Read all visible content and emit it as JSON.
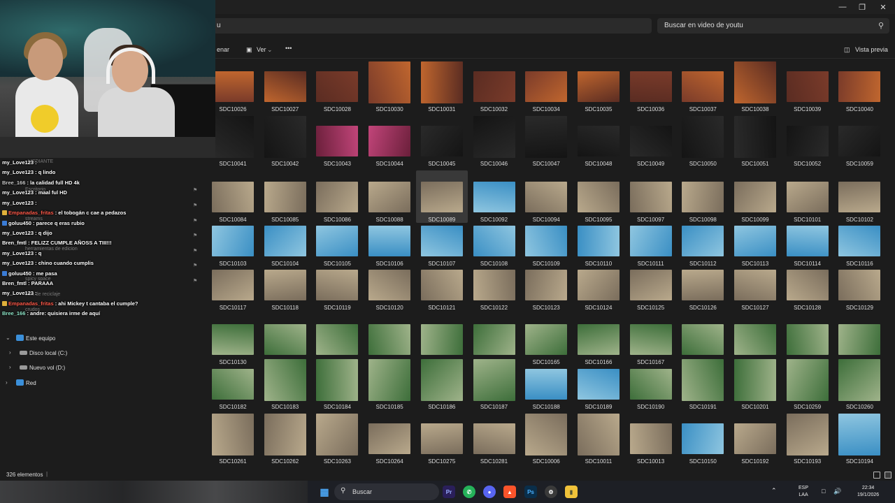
{
  "window": {
    "minimize": "—",
    "maximize": "❐",
    "close": "✕"
  },
  "address": {
    "value": "u"
  },
  "search": {
    "placeholder": "Buscar en video de youtu"
  },
  "commands": {
    "sort": "enar",
    "view": "Ver",
    "more": "•••",
    "preview": "Vista previa"
  },
  "files": [
    [
      "SDC10026",
      "SDC10027",
      "SDC10028",
      "SDC10030",
      "SDC10031",
      "SDC10032",
      "SDC10034",
      "SDC10035",
      "SDC10036",
      "SDC10037",
      "SDC10038",
      "SDC10039",
      "SDC10040"
    ],
    [
      "SDC10041",
      "SDC10042",
      "SDC10043",
      "SDC10044",
      "SDC10045",
      "SDC10046",
      "SDC10047",
      "SDC10048",
      "SDC10049",
      "SDC10050",
      "SDC10051",
      "SDC10052",
      "SDC10059"
    ],
    [
      "SDC10084",
      "SDC10085",
      "SDC10086",
      "SDC10088",
      "SDC10089",
      "SDC10092",
      "SDC10094",
      "SDC10095",
      "SDC10097",
      "SDC10098",
      "SDC10099",
      "SDC10101",
      "SDC10102"
    ],
    [
      "SDC10103",
      "SDC10104",
      "SDC10105",
      "SDC10106",
      "SDC10107",
      "SDC10108",
      "SDC10109",
      "SDC10110",
      "SDC10111",
      "SDC10112",
      "SDC10113",
      "SDC10114",
      "SDC10116"
    ],
    [
      "SDC10117",
      "SDC10118",
      "SDC10119",
      "SDC10120",
      "SDC10121",
      "SDC10122",
      "SDC10123",
      "SDC10124",
      "SDC10125",
      "SDC10126",
      "SDC10127",
      "SDC10128",
      "SDC10129"
    ],
    [
      "SDC10130",
      "SDC10131",
      "SDC10161",
      "SDC10162",
      "SDC10163",
      "SDC10164",
      "SDC10165",
      "SDC10166",
      "SDC10167",
      "SDC10176",
      "SDC10177",
      "SDC10178",
      "SDC10179"
    ],
    [
      "SDC10182",
      "SDC10183",
      "SDC10184",
      "SDC10185",
      "SDC10186",
      "SDC10187",
      "SDC10188",
      "SDC10189",
      "SDC10190",
      "SDC10191",
      "SDC10201",
      "SDC10259",
      "SDC10260"
    ],
    [
      "SDC10261",
      "SDC10262",
      "SDC10263",
      "SDC10264",
      "SDC10275",
      "SDC10281",
      "SDC10006",
      "SDC10011",
      "SDC10013",
      "SDC10150",
      "SDC10192",
      "SDC10193",
      "SDC10194"
    ]
  ],
  "selected_file": "SDC10089",
  "thumb_colors": {
    "party": [
      "#7a3b2a",
      "#c0662e",
      "#5a2c22"
    ],
    "night": [
      "#141414",
      "#2a2a2a"
    ],
    "pink": [
      "#c2457a",
      "#6a1f3a"
    ],
    "pool": [
      "#3a8fc4",
      "#8fc6e0"
    ],
    "yard": [
      "#7a6d5c",
      "#b9a98c"
    ],
    "green": [
      "#3d6e3a",
      "#9fb38a"
    ]
  },
  "nav": {
    "this_pc": "Este equipo",
    "disk_c": "Disco local (C:)",
    "disk_d": "Nuevo vol (D:)",
    "network": "Red"
  },
  "nav_ghost": [
    "Escritorio",
    "streams",
    "herramientas de edicion",
    "spicy space",
    "sala de reciclaje",
    "crudos",
    "MEDIANTE"
  ],
  "chat": [
    {
      "user": "my_Love123",
      "color": "#ffffff",
      "msg": ":"
    },
    {
      "user": "my_Love123",
      "color": "#ffffff",
      "msg": ": q lindo"
    },
    {
      "user": "Bree_166",
      "color": "#c8c8c8",
      "msg": ": la calidad full HD 4k"
    },
    {
      "user": "my_Love123",
      "color": "#ffffff",
      "msg": ": maal ful HD"
    },
    {
      "user": "my_Love123",
      "color": "#ffffff",
      "msg": ":"
    },
    {
      "user": "Empanadas_fritas",
      "color": "#ff5a4a",
      "msg": ": el tobogán c cae a pedazos"
    },
    {
      "user": "goluu450",
      "color": "#ffffff",
      "msg": ": parece q eras rubio"
    },
    {
      "user": "my_Love123",
      "color": "#ffffff",
      "msg": ": q dijo"
    },
    {
      "user": "Bren_fmtl",
      "color": "#ffffff",
      "msg": ": FELIZZ CUMPLE AÑOSS A TIII!!!"
    },
    {
      "user": "my_Love123",
      "color": "#ffffff",
      "msg": ": q"
    },
    {
      "user": "my_Love123",
      "color": "#ffffff",
      "msg": ": chino cuando cumplis"
    },
    {
      "user": "goluu450",
      "color": "#ffffff",
      "msg": ": me pasa"
    },
    {
      "user": "Bren_fmtl",
      "color": "#ffffff",
      "msg": ": PARAAA"
    },
    {
      "user": "my_Love123",
      "color": "#ffffff",
      "msg": ":"
    },
    {
      "user": "Empanadas_fritas",
      "color": "#ff5a4a",
      "msg": ": ahi Mickey t cantaba el cumple?"
    },
    {
      "user": "Bree_166",
      "color": "#8fe6c8",
      "msg": ": andre: quisiera irme de aquí"
    }
  ],
  "status": {
    "count": "326 elementos"
  },
  "taskbar": {
    "search": "Buscar",
    "lang": "ESP",
    "lang2": "LAA",
    "time": "22:34",
    "date": "19/1/2026"
  },
  "icons": {
    "search": "search-icon",
    "view": "view-icon",
    "preview": "preview-icon",
    "pc": "computer-icon",
    "disk": "drive-icon",
    "network": "network-icon",
    "windows": "windows-icon"
  }
}
